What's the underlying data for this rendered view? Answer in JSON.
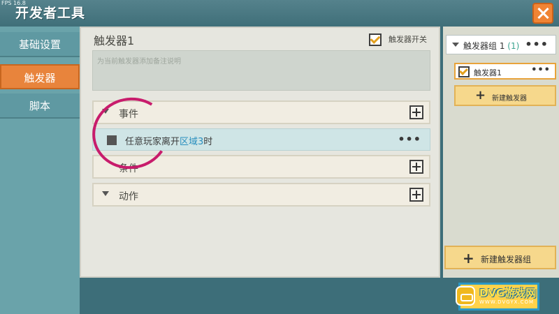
{
  "window": {
    "fps": "FPS 16.8",
    "title": "开发者工具"
  },
  "sidebar": {
    "items": [
      {
        "label": "基础设置",
        "active": false
      },
      {
        "label": "触发器",
        "active": true
      },
      {
        "label": "脚本",
        "active": false
      }
    ]
  },
  "main": {
    "trigger_name": "触发器1",
    "switch_label": "触发器开关",
    "switch_checked": true,
    "note_placeholder": "为当前触发器添加备注说明",
    "sections": [
      {
        "label": "事件"
      },
      {
        "label": "条件"
      },
      {
        "label": "动作"
      }
    ],
    "event": {
      "text_prefix": "任意玩家离开",
      "text_highlight": "区域3",
      "text_suffix": "时",
      "more": "•••"
    }
  },
  "right_panel": {
    "group": {
      "label": "触发器组 1",
      "count": "(1)",
      "more": "•••"
    },
    "trigger_item": {
      "label": "触发器1",
      "checked": true,
      "more": "•••"
    },
    "new_trigger": {
      "plus": "+",
      "label": "新建触发器"
    },
    "new_group": {
      "plus": "+",
      "label": "新建触发器组"
    }
  },
  "watermark": {
    "text": "DVG游戏网",
    "subtext": "WWW.DVGYX.COM"
  },
  "colors": {
    "accent_orange": "#e8843c",
    "button_yellow": "#f6d88c",
    "annotation_pink": "#c81c6c",
    "frame_teal": "#3d6e79"
  }
}
